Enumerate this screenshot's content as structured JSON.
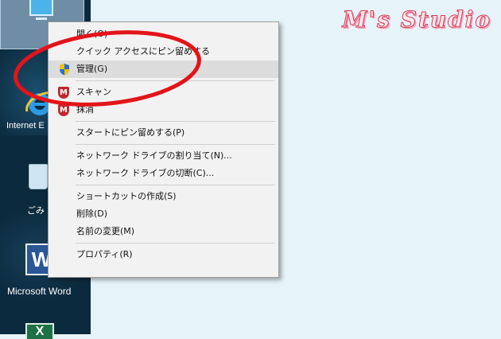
{
  "watermark": "M's Studio",
  "desktop": {
    "ie_label": "Internet E",
    "bin_label": "ごみ",
    "word_label": "Microsoft Word",
    "word_letter": "W",
    "excel_letter": "X"
  },
  "context_menu": {
    "items": [
      {
        "label": "開く(O)"
      },
      {
        "label": "クイック アクセスにピン留めする"
      },
      {
        "label": "管理(G)",
        "icon": "uac-shield-icon"
      },
      {
        "label": "スキャン",
        "icon": "mcafee-icon"
      },
      {
        "label": "抹消",
        "icon": "mcafee-icon"
      },
      {
        "label": "スタートにピン留めする(P)"
      },
      {
        "label": "ネットワーク ドライブの割り当て(N)..."
      },
      {
        "label": "ネットワーク ドライブの切断(C)..."
      },
      {
        "label": "ショートカットの作成(S)"
      },
      {
        "label": "削除(D)"
      },
      {
        "label": "名前の変更(M)"
      },
      {
        "label": "プロパティ(R)"
      }
    ]
  },
  "colors": {
    "annotation_red": "#e3141a",
    "menu_bg": "#f2f2f2",
    "desktop_bg": "#0c2a3d",
    "right_bg": "#e6f4f9"
  }
}
